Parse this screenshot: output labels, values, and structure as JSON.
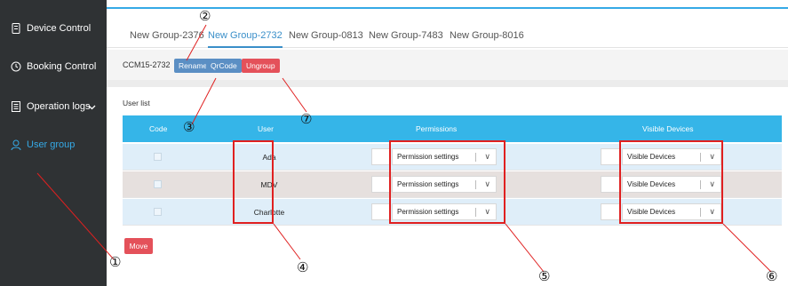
{
  "sidebar": {
    "items": [
      {
        "label": "Device Control",
        "icon": "device-icon"
      },
      {
        "label": "Booking Control",
        "icon": "clock-icon"
      },
      {
        "label": "Operation logs",
        "icon": "document-icon"
      },
      {
        "label": "User group",
        "icon": "user-icon",
        "active": true
      }
    ]
  },
  "tabs": [
    {
      "label": "New Group-2376"
    },
    {
      "label": "New Group-2732",
      "active": true
    },
    {
      "label": "New Group-0813"
    },
    {
      "label": "New Group-7483"
    },
    {
      "label": "New Group-8016"
    }
  ],
  "toolbar": {
    "group_code": "CCM15-2732",
    "rename_label": "Rename",
    "qrcode_label": "QrCode",
    "ungroup_label": "Ungroup"
  },
  "user_list": {
    "label": "User list",
    "columns": [
      "Code",
      "User",
      "Permissions",
      "Visible Devices"
    ],
    "rows": [
      {
        "user": "Ada",
        "permissions": "Permission settings",
        "devices": "Visible Devices"
      },
      {
        "user": "MDV",
        "permissions": "Permission settings",
        "devices": "Visible Devices"
      },
      {
        "user": "Charlotte",
        "permissions": "Permission settings",
        "devices": "Visible Devices"
      }
    ],
    "move_label": "Move"
  },
  "annotations": {
    "n1": "①",
    "n2": "②",
    "n3": "③",
    "n4": "④",
    "n5": "⑤",
    "n6": "⑥",
    "n7": "⑦"
  },
  "colors": {
    "sidebar_bg": "#2f3234",
    "accent": "#35b5e8",
    "button_blue": "#5b8fc4",
    "button_red": "#e4515a",
    "annotation_red": "#e02020"
  }
}
